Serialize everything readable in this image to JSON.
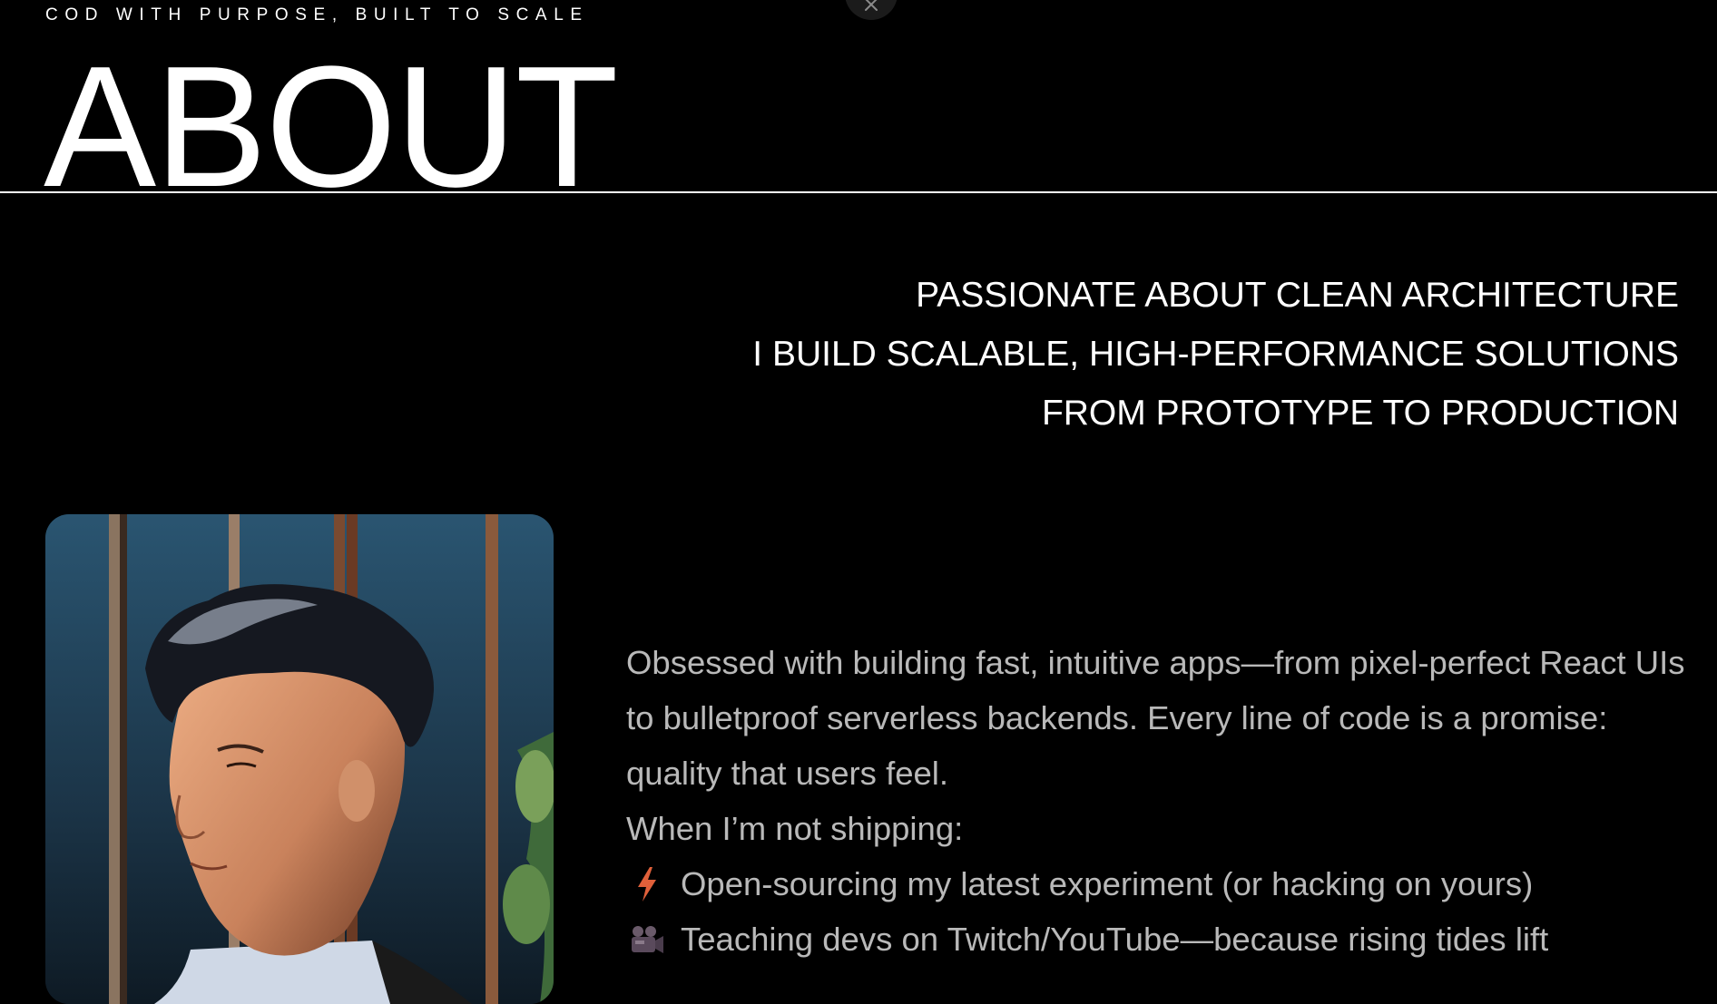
{
  "header": {
    "tagline": "COD WITH PURPOSE, BUILT TO SCALE",
    "title": "ABOUT"
  },
  "headline": {
    "lines": [
      "PASSIONATE ABOUT CLEAN ARCHITECTURE",
      "I BUILD SCALABLE, HIGH-PERFORMANCE SOLUTIONS",
      "FROM PROTOTYPE TO PRODUCTION"
    ]
  },
  "bio": {
    "intro": "Obsessed with building fast, intuitive apps—from pixel-perfect React UIs to bulletproof serverless backends. Every line of code is a promise: quality that users feel.",
    "not_shipping_label": "When I’m not shipping:",
    "items": [
      {
        "icon": "lightning-icon",
        "text": "Open-sourcing my latest experiment (or hacking on yours)"
      },
      {
        "icon": "movie-camera-icon",
        "text": "Teaching devs on Twitch/YouTube—because rising tides lift"
      }
    ]
  },
  "colors": {
    "background": "#000000",
    "text": "#ffffff",
    "body_text": "#b9b9b9",
    "bolt": "#e0603a"
  }
}
